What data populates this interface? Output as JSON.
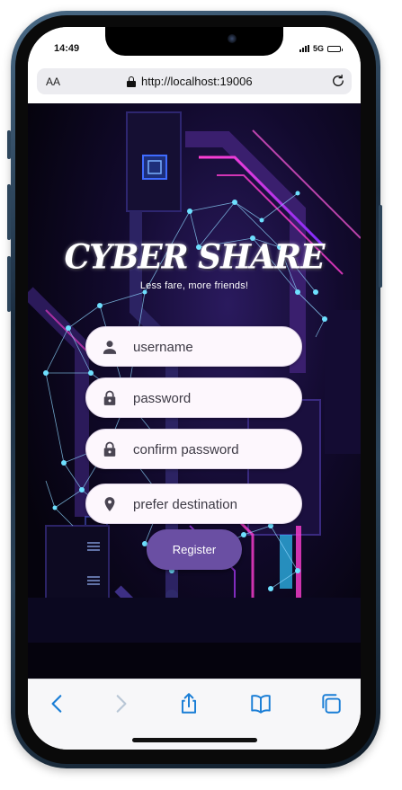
{
  "status_bar": {
    "time": "14:49",
    "network": "5G"
  },
  "browser": {
    "text_size_label": "AA",
    "url": "http://localhost:19006"
  },
  "app": {
    "title": "CYBER SHARE",
    "tagline": "Less fare, more friends!",
    "fields": [
      {
        "placeholder": "username",
        "icon": "person-icon"
      },
      {
        "placeholder": "password",
        "icon": "lock-icon"
      },
      {
        "placeholder": "confirm password",
        "icon": "lock-icon"
      },
      {
        "placeholder": "prefer destination",
        "icon": "location-pin-icon"
      }
    ],
    "register_label": "Register",
    "accent_color": "#6a4fa3",
    "field_background": "#fdf7fd"
  },
  "toolbar": {
    "items": [
      "back-icon",
      "forward-icon",
      "share-icon",
      "bookmarks-icon",
      "tabs-icon"
    ],
    "accent_color": "#1a7ed6"
  }
}
